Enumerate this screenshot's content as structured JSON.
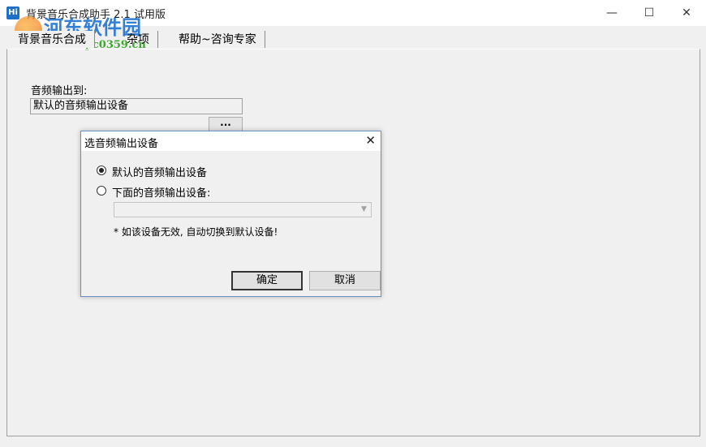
{
  "window": {
    "app_icon_text": "Hi",
    "title": "背景音乐合成助手 2.1 试用版",
    "controls": {
      "minimize": "—",
      "maximize": "☐",
      "close": "✕"
    }
  },
  "watermark": {
    "text": "河东软件园",
    "url": "www.pc0359.cn"
  },
  "tabs": [
    {
      "label": "背景音乐合成"
    },
    {
      "label": "杂项"
    },
    {
      "label": "帮助~咨询专家"
    }
  ],
  "output": {
    "label": "音频输出到:",
    "value": "默认的音频输出设备",
    "browse_label": "..."
  },
  "dialog": {
    "title": "选音频输出设备",
    "close": "✕",
    "option_default": "默认的音频输出设备",
    "option_custom": "下面的音频输出设备:",
    "selected_option": "default",
    "combo_value": "",
    "combo_arrow": "▼",
    "note": "* 如该设备无效, 自动切换到默认设备!",
    "ok_label": "确定",
    "cancel_label": "取消"
  }
}
